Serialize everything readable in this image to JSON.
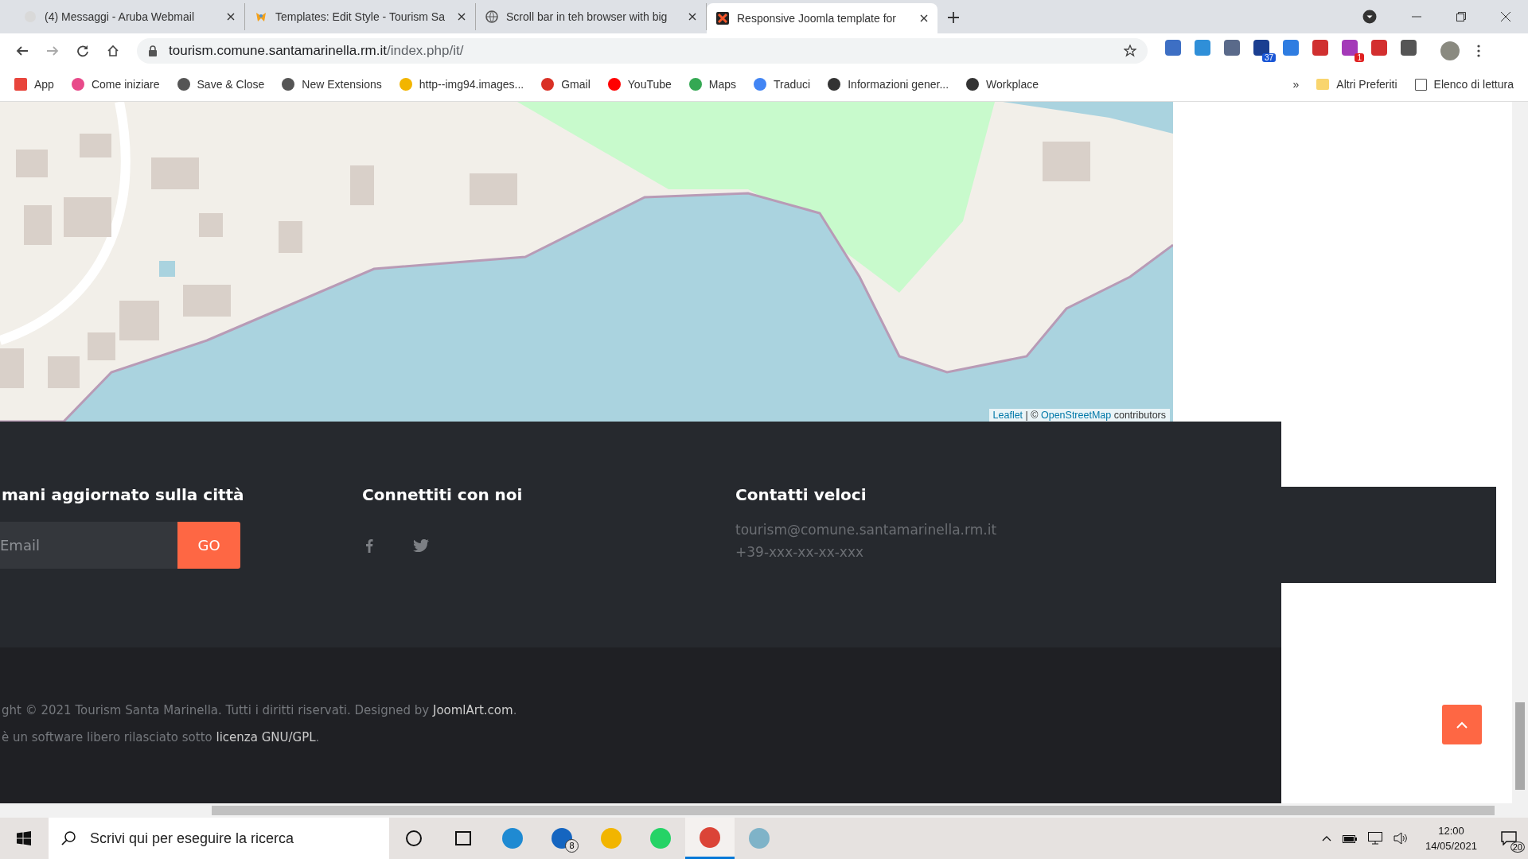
{
  "browser": {
    "tabs": [
      {
        "title": "(4) Messaggi - Aruba Webmail",
        "selected": false
      },
      {
        "title": "Templates: Edit Style - Tourism Sa",
        "selected": false
      },
      {
        "title": "Scroll bar in teh browser with big",
        "selected": false
      },
      {
        "title": "Responsive Joomla template for",
        "selected": true
      }
    ],
    "address": {
      "host": "tourism.comune.santamarinella.rm.it",
      "path": "/index.php/it/"
    },
    "extensions": [
      {
        "kind": "plain"
      },
      {
        "kind": "plain"
      },
      {
        "kind": "plain"
      },
      {
        "kind": "badged",
        "badge": "37"
      },
      {
        "kind": "plain"
      },
      {
        "kind": "plain"
      },
      {
        "kind": "badged",
        "badge": "1"
      },
      {
        "kind": "plain"
      },
      {
        "kind": "plain"
      }
    ],
    "bookmarks": [
      "App",
      "Come iniziare",
      "Save & Close",
      "New Extensions",
      "http--img94.images...",
      "Gmail",
      "YouTube",
      "Maps",
      "Traduci",
      "Informazioni gener...",
      "Workplace"
    ],
    "more_bookmarks": "»",
    "other_bookmarks": "Altri Preferiti",
    "reading_list": "Elenco di lettura"
  },
  "map": {
    "attribution": [
      {
        "text": "Leaflet",
        "link": true
      },
      {
        "text": " | © ",
        "link": false
      },
      {
        "text": "OpenStreetMap",
        "link": true
      },
      {
        "text": " contributors",
        "link": false
      }
    ]
  },
  "footer": {
    "columns": [
      {
        "heading": "mani aggiornato sulla città",
        "kind": "newsletter",
        "placeholder": "Email",
        "button": "GO"
      },
      {
        "heading": "Connettiti con noi",
        "kind": "social"
      },
      {
        "heading": "Contatti veloci",
        "kind": "contacts",
        "lines": [
          "tourism@comune.santamarinella.rm.it",
          "+39-xxx-xx-xx-xxx"
        ]
      }
    ],
    "copyright": [
      [
        {
          "text": "ght © 2021 Tourism Santa Marinella. Tutti i diritti riservati. Designed by ",
          "link": false
        },
        {
          "text": "JoomlArt.com",
          "link": true
        },
        {
          "text": ".",
          "link": false
        }
      ],
      [
        {
          "text": "è un software libero rilasciato sotto ",
          "link": false
        },
        {
          "text": "licenza GNU/GPL",
          "link": true
        },
        {
          "text": ".",
          "link": false
        }
      ]
    ]
  },
  "taskbar": {
    "search_placeholder": "Scrivi qui per eseguire la ricerca",
    "apps": [
      {
        "selected": false
      },
      {
        "selected": false
      },
      {
        "selected": false
      },
      {
        "badge": "8",
        "selected": false
      },
      {
        "selected": false
      },
      {
        "selected": false
      },
      {
        "selected": true
      },
      {
        "selected": false
      }
    ],
    "time": "12:00",
    "date": "14/05/2021",
    "notifications": "20"
  }
}
